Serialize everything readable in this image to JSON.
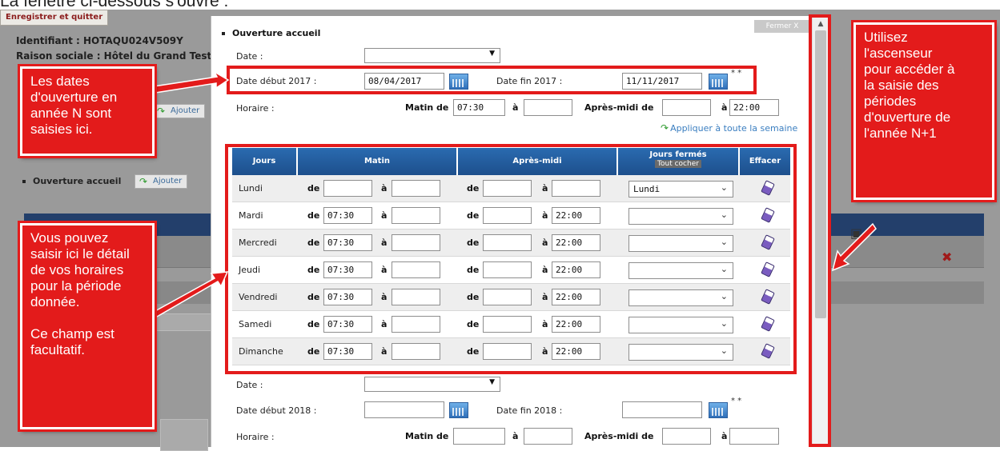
{
  "instruction_text": "La fenêtre ci-dessous s'ouvre :",
  "background": {
    "save_button": "Enregistrer et quitter",
    "identifiant": "Identifiant :  HOTAQU024V509Y",
    "raison_sociale": "Raison sociale : Hôtel du Grand Test",
    "ajouter_label": "Ajouter",
    "ouverture_accueil": "Ouverture accueil",
    "ajouter2_label": "Ajouter"
  },
  "modal": {
    "close_label": "Fermer X",
    "section_title": "Ouverture accueil",
    "date_label": "Date :",
    "period_2017": {
      "start_label": "Date début 2017 :",
      "start_value": "08/04/2017",
      "end_label": "Date fin 2017 :",
      "end_value": "11/11/2017",
      "required_mark": "* *"
    },
    "horaire_label": "Horaire :",
    "matin_de_label": "Matin de",
    "matin_start": "07:30",
    "a_label": "à",
    "matin_end": "",
    "apres_midi_label": "Après-midi de",
    "apres_start": "",
    "apres_end": "22:00",
    "apply_week_label": "Appliquer à toute la semaine",
    "table": {
      "headers": {
        "jours": "Jours",
        "matin": "Matin",
        "apres_midi": "Après-midi",
        "jours_fermes": "Jours fermés",
        "tout_cocher": "Tout cocher",
        "effacer": "Effacer"
      },
      "de_label": "de",
      "a_label": "à",
      "rows": [
        {
          "day": "Lundi",
          "m_start": "",
          "m_end": "",
          "a_start": "",
          "a_end": "",
          "closed": "Lundi"
        },
        {
          "day": "Mardi",
          "m_start": "07:30",
          "m_end": "",
          "a_start": "",
          "a_end": "22:00",
          "closed": ""
        },
        {
          "day": "Mercredi",
          "m_start": "07:30",
          "m_end": "",
          "a_start": "",
          "a_end": "22:00",
          "closed": ""
        },
        {
          "day": "Jeudi",
          "m_start": "07:30",
          "m_end": "",
          "a_start": "",
          "a_end": "22:00",
          "closed": ""
        },
        {
          "day": "Vendredi",
          "m_start": "07:30",
          "m_end": "",
          "a_start": "",
          "a_end": "22:00",
          "closed": ""
        },
        {
          "day": "Samedi",
          "m_start": "07:30",
          "m_end": "",
          "a_start": "",
          "a_end": "22:00",
          "closed": ""
        },
        {
          "day": "Dimanche",
          "m_start": "07:30",
          "m_end": "",
          "a_start": "",
          "a_end": "22:00",
          "closed": ""
        }
      ]
    },
    "date_label_2": "Date :",
    "period_2018": {
      "start_label": "Date début 2018 :",
      "start_value": "",
      "end_label": "Date fin 2018 :",
      "end_value": "",
      "required_mark": "* *"
    },
    "horaire_label_2": "Horaire :",
    "matin_de_label_2": "Matin de",
    "a_label_2": "à",
    "apres_midi_label_2": "Après-midi de",
    "a_label_3": "à"
  },
  "callouts": {
    "dates": "Les dates\nd'ouverture en\nannée N sont\nsaisies ici.",
    "horaires": "Vous pouvez\nsaisir ici le détail\nde vos horaires\npour la période\ndonnée.\n\nCe champ est\nfacultatif.",
    "scroll": "Utilisez\nl'ascenseur\npour accéder à\nla saisie des\npériodes\nd'ouverture de\nl'année N+1"
  },
  "colors": {
    "callout_red": "#e31b1b",
    "table_header_blue": "#1d4f8c",
    "link_blue": "#3a7ec0"
  }
}
